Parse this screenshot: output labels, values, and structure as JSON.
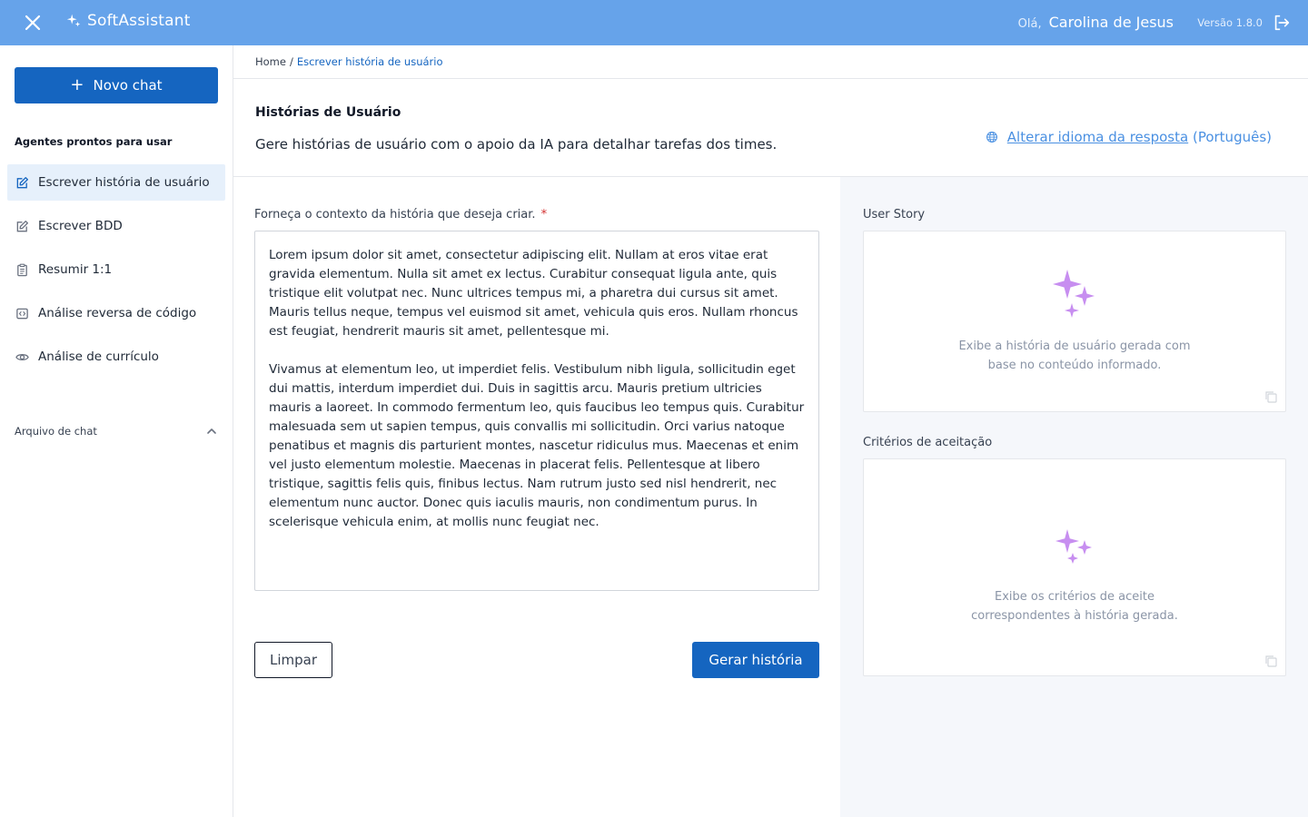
{
  "topbar": {
    "brand": "SoftAssistant",
    "greeting": "Olá,",
    "user_name": "Carolina de Jesus",
    "version": "Versão 1.8.0"
  },
  "sidebar": {
    "new_chat_label": "Novo chat",
    "agents_title": "Agentes prontos para usar",
    "items": [
      {
        "label": "Escrever história de usuário",
        "icon": "edit-icon",
        "active": true
      },
      {
        "label": "Escrever BDD",
        "icon": "edit-icon",
        "active": false
      },
      {
        "label": "Resumir 1:1",
        "icon": "clipboard-icon",
        "active": false
      },
      {
        "label": "Análise reversa de código",
        "icon": "code-icon",
        "active": false
      },
      {
        "label": "Análise de currículo",
        "icon": "eye-icon",
        "active": false
      }
    ],
    "archive_label": "Arquivo de chat"
  },
  "breadcrumb": {
    "home": "Home",
    "separator": "/",
    "current": "Escrever história de usuário"
  },
  "header": {
    "title": "Histórias de Usuário",
    "subtitle": "Gere histórias de usuário com o apoio da IA para detalhar tarefas dos times.",
    "lang_link": "Alterar idioma da resposta",
    "lang_current": "(Português)"
  },
  "form": {
    "label": "Forneça o contexto da história que deseja criar.",
    "required_mark": "*",
    "value": "Lorem ipsum dolor sit amet, consectetur adipiscing elit. Nullam at eros vitae erat gravida elementum. Nulla sit amet ex lectus. Curabitur consequat ligula ante, quis tristique elit volutpat nec. Nunc ultrices tempus mi, a pharetra dui cursus sit amet. Mauris tellus neque, tempus vel euismod sit amet, vehicula quis eros. Nullam rhoncus est feugiat, hendrerit mauris sit amet, pellentesque mi.\n\nVivamus at elementum leo, ut imperdiet felis. Vestibulum nibh ligula, sollicitudin eget dui mattis, interdum imperdiet dui. Duis in sagittis arcu. Mauris pretium ultricies mauris a laoreet. In commodo fermentum leo, quis faucibus leo tempus quis. Curabitur malesuada sem ut sapien tempus, quis convallis mi sollicitudin. Orci varius natoque penatibus et magnis dis parturient montes, nascetur ridiculus mus. Maecenas et enim vel justo elementum molestie. Maecenas in placerat felis. Pellentesque at libero tristique, sagittis felis quis, finibus lectus. Nam rutrum justo sed nisl hendrerit, nec elementum nunc auctor. Donec quis iaculis mauris, non condimentum purus. In scelerisque vehicula enim, at mollis nunc feugiat nec.",
    "clear_label": "Limpar",
    "generate_label": "Gerar história"
  },
  "outputs": {
    "user_story": {
      "label": "User Story",
      "hint": "Exibe a história de usuário gerada com\nbase no conteúdo informado."
    },
    "criteria": {
      "label": "Critérios de aceitação",
      "hint": "Exibe os critérios de aceite\ncorrespondentes à história gerada."
    }
  },
  "colors": {
    "topbar": "#66a3ea",
    "primary": "#1565c0",
    "active_bg": "#e6f0fb",
    "sparkle": "#c78ef0",
    "panel_bg": "#f5f7fb"
  }
}
